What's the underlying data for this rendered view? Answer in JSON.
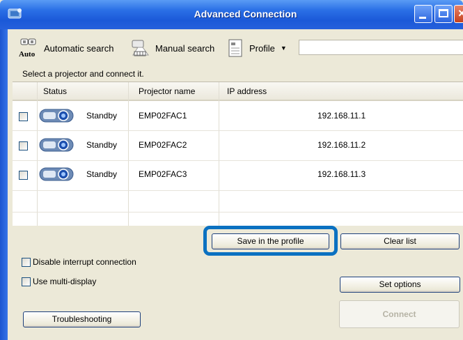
{
  "window": {
    "title": "Advanced Connection",
    "colors": {
      "titlebar": "#2a6fe6",
      "highlight": "#0b71c1",
      "face": "#ece9d8"
    }
  },
  "toolbar": {
    "automatic_search": "Automatic search",
    "auto_badge": "Auto",
    "manual_search": "Manual search",
    "profile": "Profile",
    "profile_field_value": ""
  },
  "hint": "Select a projector and connect it.",
  "table": {
    "columns": [
      "Status",
      "Projector name",
      "IP address"
    ],
    "rows": [
      {
        "checked": false,
        "status": "Standby",
        "name": "EMP02FAC1",
        "ip": "192.168.11.1",
        "icon": "projector-icon"
      },
      {
        "checked": false,
        "status": "Standby",
        "name": "EMP02FAC2",
        "ip": "192.168.11.2",
        "icon": "projector-icon"
      },
      {
        "checked": false,
        "status": "Standby",
        "name": "EMP02FAC3",
        "ip": "192.168.11.3",
        "icon": "projector-icon"
      }
    ]
  },
  "buttons": {
    "save_profile": "Save in the profile",
    "clear_list": "Clear list",
    "set_options": "Set options",
    "troubleshooting": "Troubleshooting",
    "connect": "Connect"
  },
  "options": {
    "disable_interrupt": "Disable interrupt connection",
    "disable_interrupt_checked": false,
    "use_multi_display": "Use multi-display",
    "use_multi_display_checked": false
  }
}
